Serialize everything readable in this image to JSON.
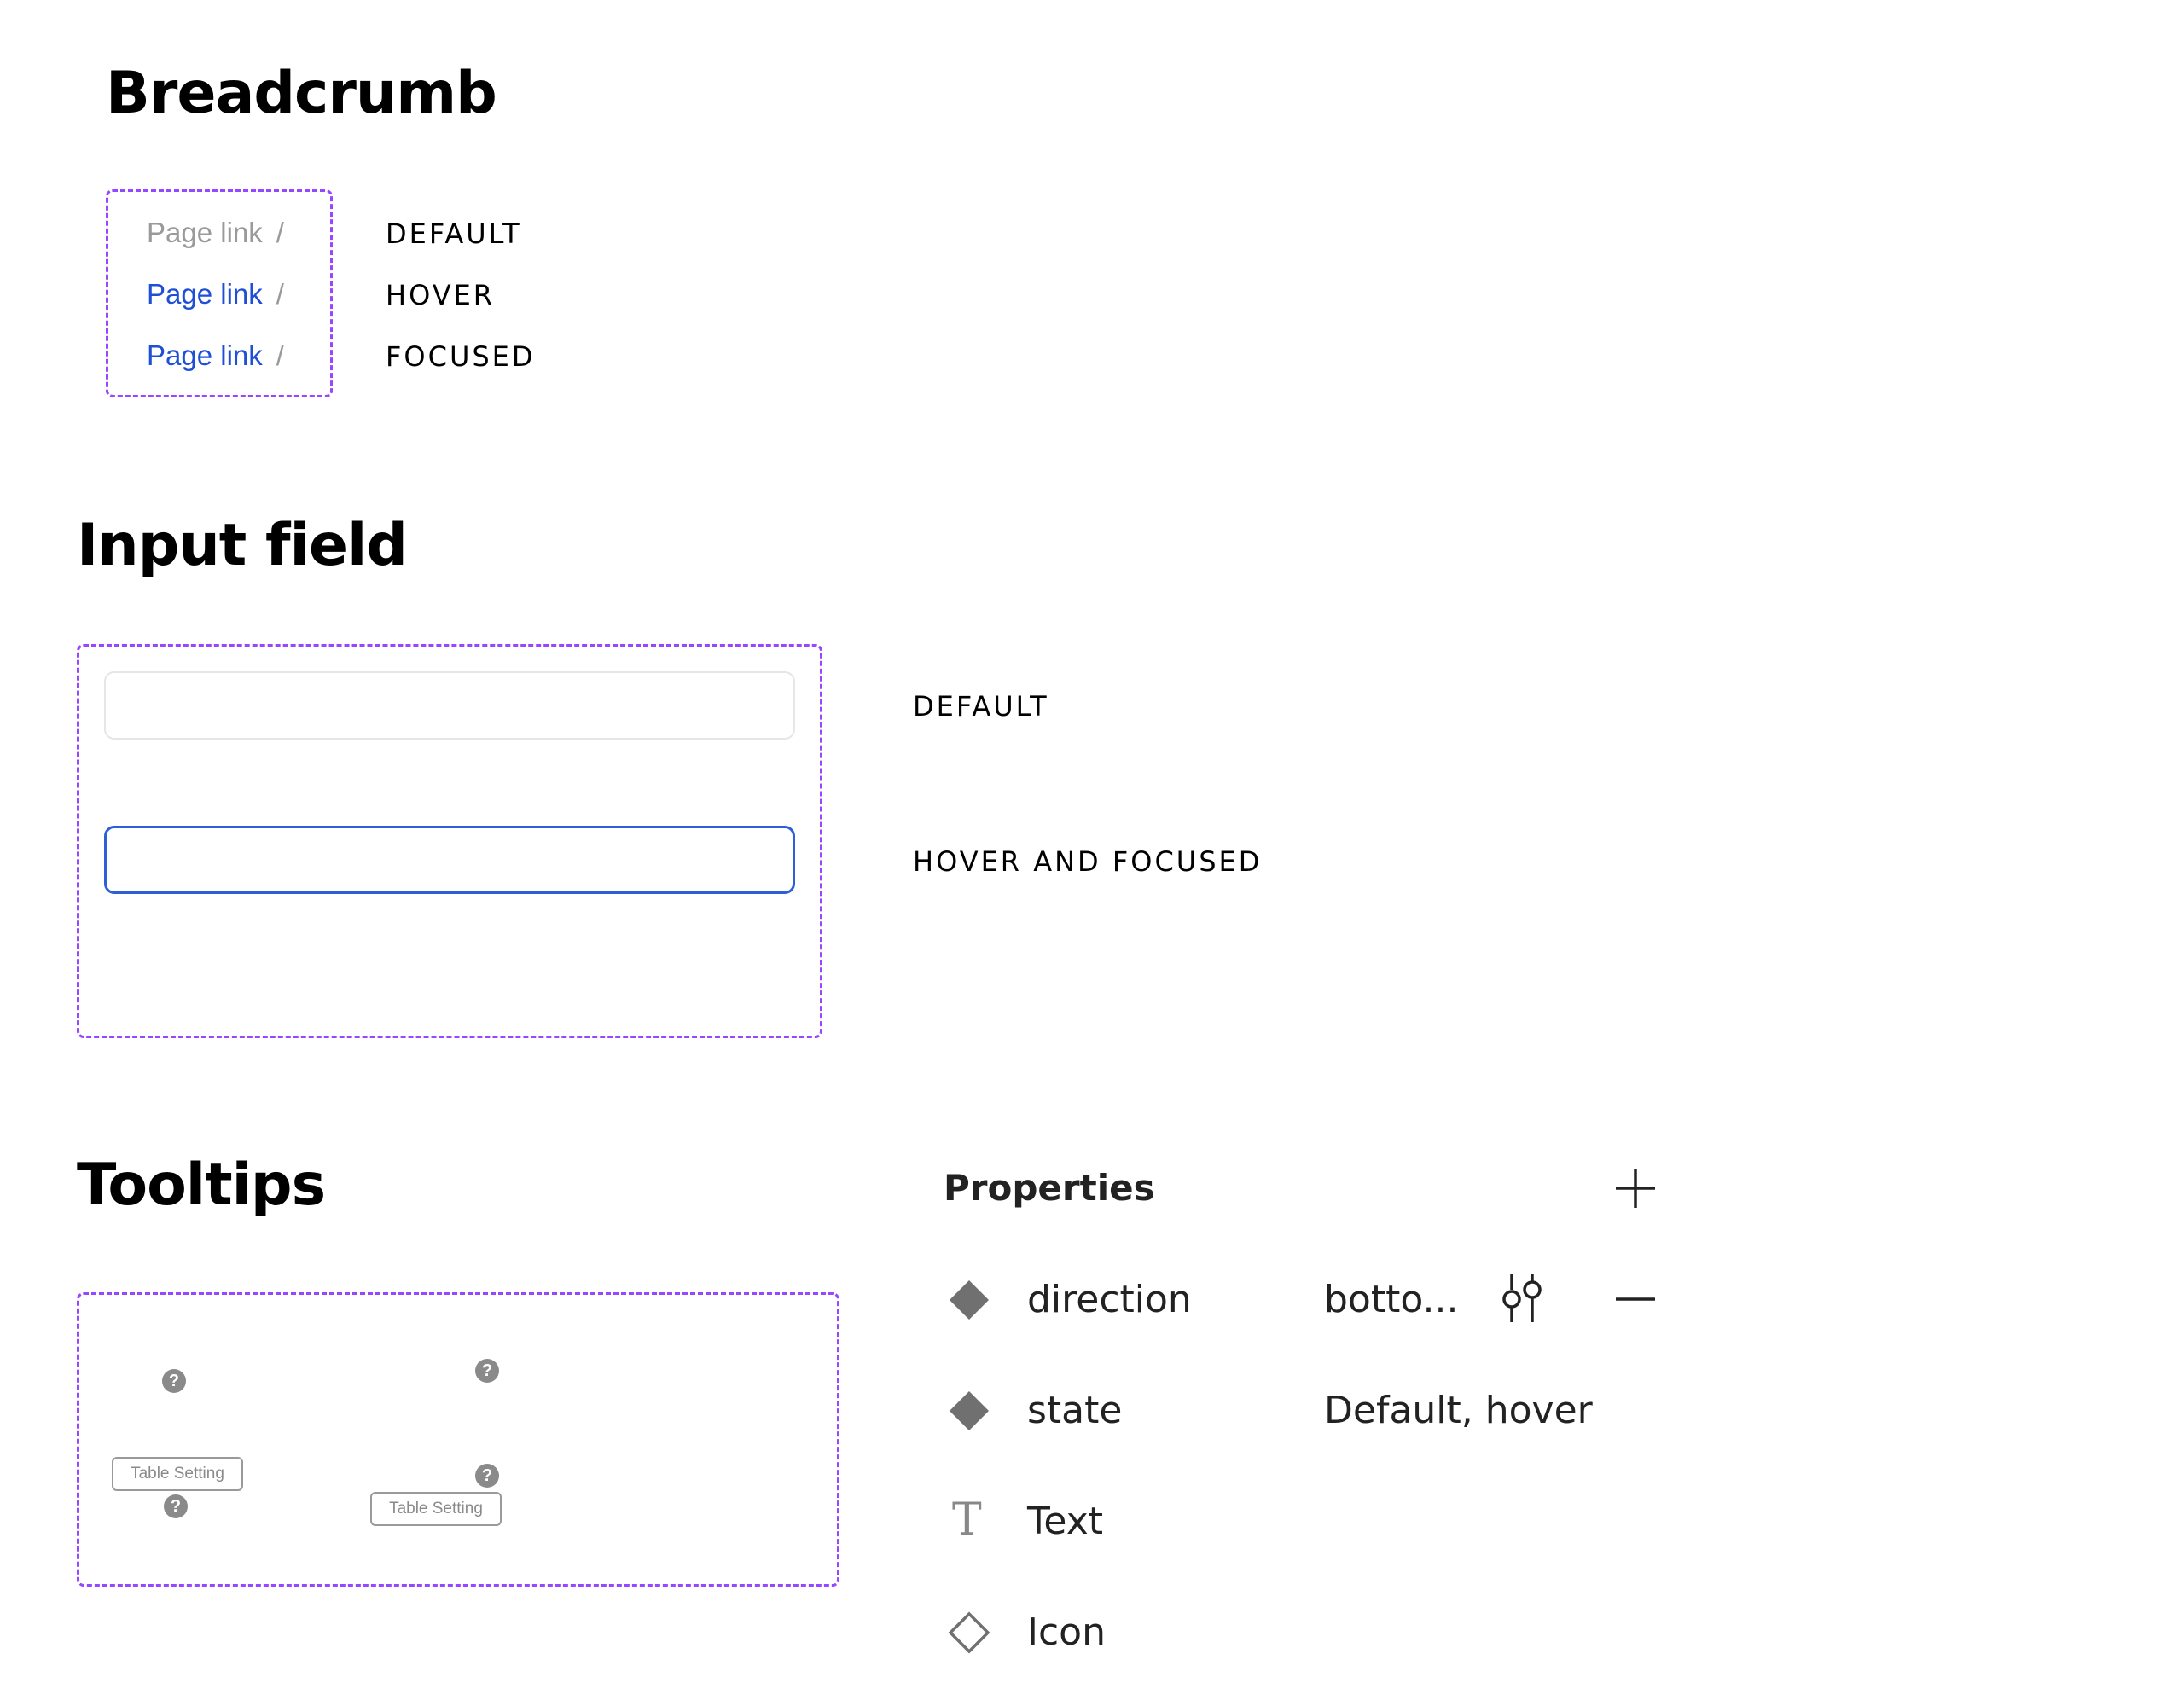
{
  "breadcrumb": {
    "title": "Breadcrumb",
    "items": [
      {
        "link": "Page link",
        "separator": "/",
        "state": "DEFAULT"
      },
      {
        "link": "Page link",
        "separator": "/",
        "state": "HOVER"
      },
      {
        "link": "Page link",
        "separator": "/",
        "state": "FOCUSED"
      }
    ]
  },
  "input_field": {
    "title": "Input field",
    "states": [
      "DEFAULT",
      "HOVER AND FOCUSED"
    ]
  },
  "tooltips": {
    "title": "Tooltips",
    "help_glyph": "?",
    "tooltip_text": "Table Setting"
  },
  "properties": {
    "title": "Properties",
    "rows": [
      {
        "name": "direction",
        "value": "botto...",
        "icon": "diamond-filled-icon"
      },
      {
        "name": "state",
        "value": "Default, hover",
        "icon": "diamond-filled-icon"
      },
      {
        "name": "Text",
        "icon": "text-type-icon",
        "glyph": "T"
      },
      {
        "name": "Icon",
        "icon": "diamond-outline-icon"
      }
    ]
  },
  "colors": {
    "dashed_border": "#9747ff",
    "link_active": "#1f4fd6",
    "link_default": "#9a9a9a",
    "focus_border": "#2e5fd8"
  }
}
